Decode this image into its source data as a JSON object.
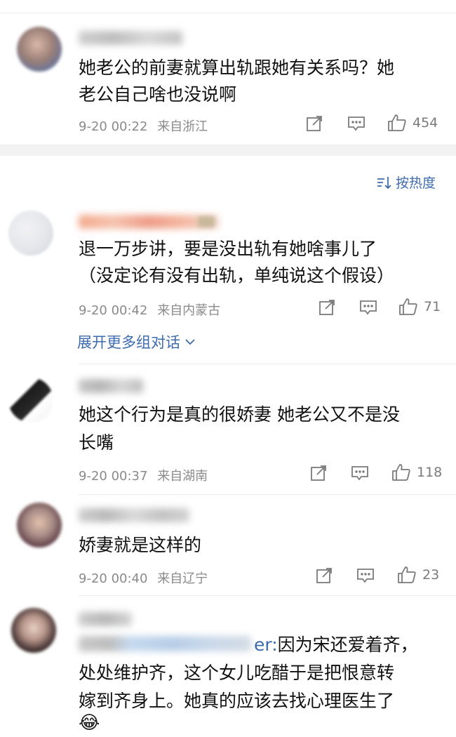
{
  "comments": [
    {
      "text1": "她老公的前妻就算出轨跟她有关系吗？她",
      "text2": "老公自己啥也没说啊",
      "date": "9-20 00:22",
      "location": "来自浙江",
      "likes": "454"
    },
    {
      "text1": "退一万步讲，要是没出轨有她啥事儿了",
      "text2": "（没定论有没有出轨，单纯说这个假设）",
      "date": "9-20 00:42",
      "location": "来自内蒙古",
      "likes": "71"
    },
    {
      "text1": "她这个行为是真的很娇妻 她老公又不是没",
      "text2": "长嘴",
      "date": "9-20 00:37",
      "location": "来自湖南",
      "likes": "118"
    },
    {
      "text1": "娇妻就是这样的",
      "date": "9-20 00:40",
      "location": "来自辽宁",
      "likes": "23"
    },
    {
      "mention_tail": "er:",
      "text1": "因为宋还爱着齐，",
      "text2": "处处维护齐，这个女儿吃醋于是把恨意转",
      "text3": "嫁到齐身上。她真的应该去找心理医生了",
      "emoji": "😂"
    }
  ],
  "sort_label": "按热度",
  "expand_label": "展开更多组对话"
}
